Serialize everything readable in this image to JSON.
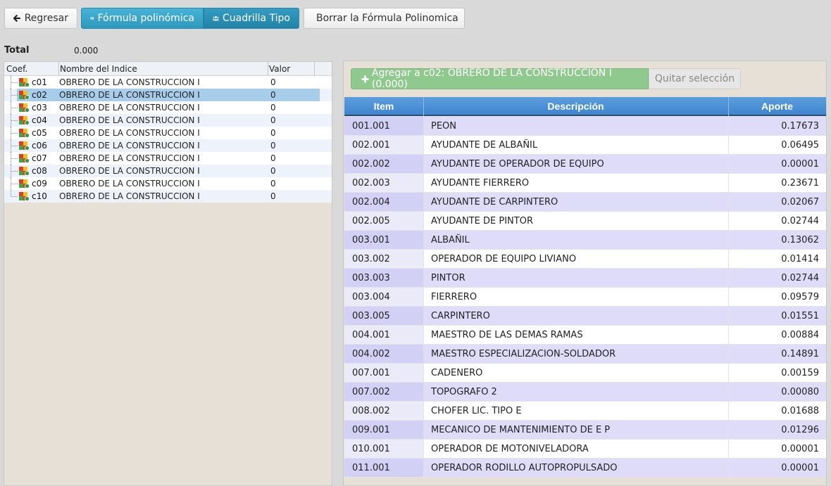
{
  "toolbar": {
    "back_label": "Regresar",
    "formula_label": "Fórmula polinómica",
    "crew_label": "Cuadrilla Tipo",
    "delete_label": "Borrar la Fórmula Polinomica"
  },
  "total": {
    "label": "Total",
    "value": "0.000"
  },
  "tree": {
    "columns": [
      "Coef.",
      "Nombre del Indice",
      "Valor"
    ],
    "rows": [
      {
        "code": "c01",
        "name": "OBRERO DE LA CONSTRUCCION I",
        "value": "0"
      },
      {
        "code": "c02",
        "name": "OBRERO DE LA CONSTRUCCION I",
        "value": "0"
      },
      {
        "code": "c03",
        "name": "OBRERO DE LA CONSTRUCCION I",
        "value": "0"
      },
      {
        "code": "c04",
        "name": "OBRERO DE LA CONSTRUCCION I",
        "value": "0"
      },
      {
        "code": "c05",
        "name": "OBRERO DE LA CONSTRUCCION I",
        "value": "0"
      },
      {
        "code": "c06",
        "name": "OBRERO DE LA CONSTRUCCION I",
        "value": "0"
      },
      {
        "code": "c07",
        "name": "OBRERO DE LA CONSTRUCCION I",
        "value": "0"
      },
      {
        "code": "c08",
        "name": "OBRERO DE LA CONSTRUCCION I",
        "value": "0"
      },
      {
        "code": "c09",
        "name": "OBRERO DE LA CONSTRUCCION I",
        "value": "0"
      },
      {
        "code": "c10",
        "name": "OBRERO DE LA CONSTRUCCION I",
        "value": "0"
      }
    ]
  },
  "actions": {
    "add_label": "Agregar a c02: OBRERO DE LA CONSTRUCCION I (0.000)",
    "clear_label": "Quitar selección"
  },
  "grid": {
    "columns": [
      "Item",
      "Descripción",
      "Aporte"
    ],
    "rows": [
      {
        "item": "001.001",
        "desc": "PEON",
        "aporte": "0.17673"
      },
      {
        "item": "002.001",
        "desc": "AYUDANTE DE ALBAÑIL",
        "aporte": "0.06495"
      },
      {
        "item": "002.002",
        "desc": "AYUDANTE DE OPERADOR DE EQUIPO",
        "aporte": "0.00001"
      },
      {
        "item": "002.003",
        "desc": "AYUDANTE FIERRERO",
        "aporte": "0.23671"
      },
      {
        "item": "002.004",
        "desc": "AYUDANTE DE CARPINTERO",
        "aporte": "0.02067"
      },
      {
        "item": "002.005",
        "desc": "AYUDANTE DE PINTOR",
        "aporte": "0.02744"
      },
      {
        "item": "003.001",
        "desc": "ALBAÑIL",
        "aporte": "0.13062"
      },
      {
        "item": "003.002",
        "desc": "OPERADOR DE EQUIPO LIVIANO",
        "aporte": "0.01414"
      },
      {
        "item": "003.003",
        "desc": "PINTOR",
        "aporte": "0.02744"
      },
      {
        "item": "003.004",
        "desc": "FIERRERO",
        "aporte": "0.09579"
      },
      {
        "item": "003.005",
        "desc": "CARPINTERO",
        "aporte": "0.01551"
      },
      {
        "item": "004.001",
        "desc": "MAESTRO DE LAS DEMAS RAMAS",
        "aporte": "0.00884"
      },
      {
        "item": "004.002",
        "desc": "MAESTRO ESPECIALIZACION-SOLDADOR",
        "aporte": "0.14891"
      },
      {
        "item": "007.001",
        "desc": "CADENERO",
        "aporte": "0.00159"
      },
      {
        "item": "007.002",
        "desc": "TOPOGRAFO 2",
        "aporte": "0.00080"
      },
      {
        "item": "008.002",
        "desc": "CHOFER LIC. TIPO E",
        "aporte": "0.01688"
      },
      {
        "item": "009.001",
        "desc": "MECANICO DE MANTENIMIENTO DE E P",
        "aporte": "0.01296"
      },
      {
        "item": "010.001",
        "desc": "OPERADOR DE MOTONIVELADORA",
        "aporte": "0.00001"
      },
      {
        "item": "011.001",
        "desc": "OPERADOR RODILLO AUTOPROPULSADO",
        "aporte": "0.00001"
      }
    ]
  },
  "colors": {
    "accent_blue": "#3a9ec4",
    "add_green": "#8fc98e",
    "grid_header": "#4a8fd5",
    "selection": "#a8cdea"
  }
}
